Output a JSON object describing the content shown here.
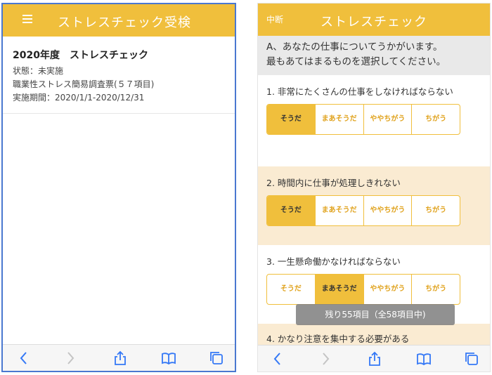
{
  "left_screen": {
    "header": {
      "title": "ストレスチェック受検",
      "menu_icon": "hamburger-menu-icon"
    },
    "survey": {
      "title": "2020年度　ストレスチェック",
      "status": "状態：未実施",
      "questionnaire": "職業性ストレス簡易調査票(５７項目)",
      "period": "実施期間：2020/1/1-2020/12/31"
    }
  },
  "right_screen": {
    "header": {
      "abort_label": "中断",
      "title": "ストレスチェック"
    },
    "section": {
      "line1": "A、あなたの仕事についてうかがいます。",
      "line2": "最もあてはまるものを選択してください。"
    },
    "questions": [
      {
        "text": "1. 非常にたくさんの仕事をしなければならない",
        "options": [
          "そうだ",
          "まあそうだ",
          "ややちがう",
          "ちがう"
        ],
        "selected": 0
      },
      {
        "text": "2. 時間内に仕事が処理しきれない",
        "options": [
          "そうだ",
          "まあそうだ",
          "ややちがう",
          "ちがう"
        ],
        "selected": 0
      },
      {
        "text": "3. 一生懸命働かなければならない",
        "options": [
          "そうだ",
          "まあそうだ",
          "ややちがう",
          "ちがう"
        ],
        "selected": 1
      },
      {
        "text": "4. かなり注意を集中する必要がある"
      }
    ],
    "toast": "残り55項目（全58項目中)"
  },
  "toolbar_icons": [
    "back-icon",
    "forward-icon",
    "share-icon",
    "bookmarks-icon",
    "tabs-icon"
  ],
  "colors": {
    "accent": "#f0bf3c",
    "accent_text": "#e0a21c",
    "highlight_row": "#faebd2",
    "section_bg": "#e9e9e9",
    "frame_blue": "#4a78d0"
  }
}
